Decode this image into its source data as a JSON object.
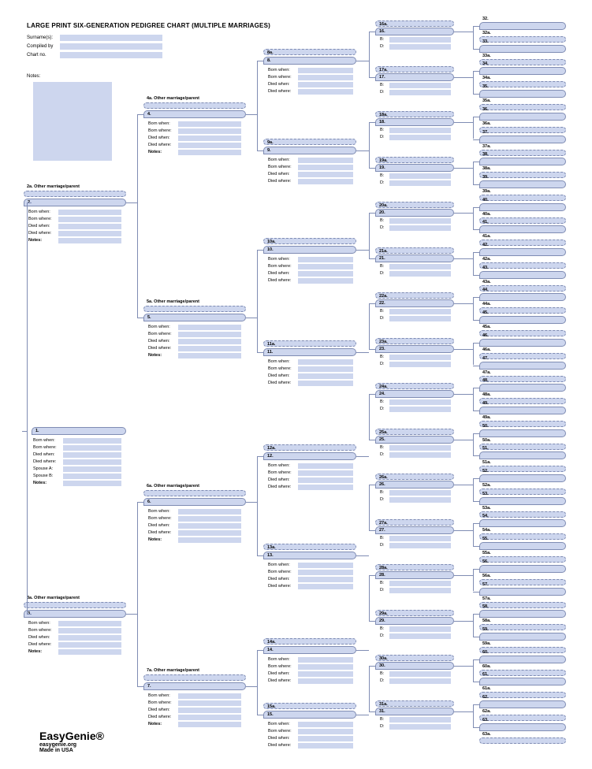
{
  "title": "LARGE PRINT SIX-GENERATION PEDIGREE CHART (MULTIPLE MARRIAGES)",
  "meta": {
    "surname": "Surname(s):",
    "compiled": "Compiled by",
    "chartno": "Chart no."
  },
  "notes_label": "Notes:",
  "labels": {
    "other": "Other marriage/parent",
    "bornwhen": "Born when:",
    "bornwhere": "Born where:",
    "diedwhen": "Died when:",
    "diedwhere": "Died where:",
    "notes": "Notes:",
    "spouseA": "Spouse A:",
    "spouseB": "Spouse B:",
    "b": "B:",
    "d": "D:"
  },
  "footer": {
    "brand": "EasyGenie®",
    "url": "easygenie.org",
    "made": "Made in USA"
  },
  "g1": {
    "num": "1."
  },
  "g2": [
    {
      "num": "2.",
      "alt": "2a."
    },
    {
      "num": "3.",
      "alt": "3a."
    }
  ],
  "g3": [
    {
      "num": "4.",
      "alt": "4a."
    },
    {
      "num": "5.",
      "alt": "5a."
    },
    {
      "num": "6.",
      "alt": "6a."
    },
    {
      "num": "7.",
      "alt": "7a."
    }
  ],
  "g4": [
    {
      "num": "8.",
      "alt": "8a."
    },
    {
      "num": "9.",
      "alt": "9a."
    },
    {
      "num": "10.",
      "alt": "10a."
    },
    {
      "num": "11.",
      "alt": "11a."
    },
    {
      "num": "12.",
      "alt": "12a."
    },
    {
      "num": "13.",
      "alt": "13a."
    },
    {
      "num": "14.",
      "alt": "14a."
    },
    {
      "num": "15.",
      "alt": "15a."
    }
  ],
  "g5": [
    {
      "num": "16.",
      "alt": "16a."
    },
    {
      "num": "17.",
      "alt": "17a."
    },
    {
      "num": "18.",
      "alt": "18a."
    },
    {
      "num": "19.",
      "alt": "19a."
    },
    {
      "num": "20.",
      "alt": "20a."
    },
    {
      "num": "21.",
      "alt": "21a."
    },
    {
      "num": "22.",
      "alt": "22a."
    },
    {
      "num": "23.",
      "alt": "23a."
    },
    {
      "num": "24.",
      "alt": "24a."
    },
    {
      "num": "25.",
      "alt": "25a."
    },
    {
      "num": "26.",
      "alt": "26a."
    },
    {
      "num": "27.",
      "alt": "27a."
    },
    {
      "num": "28.",
      "alt": "28a."
    },
    {
      "num": "29.",
      "alt": "29a."
    },
    {
      "num": "30.",
      "alt": "30a."
    },
    {
      "num": "31.",
      "alt": "31a."
    }
  ],
  "g6": [
    {
      "num": "32.",
      "alt": "32a."
    },
    {
      "num": "33.",
      "alt": "33a."
    },
    {
      "num": "34.",
      "alt": "34a."
    },
    {
      "num": "35.",
      "alt": "35a."
    },
    {
      "num": "36.",
      "alt": "36a."
    },
    {
      "num": "37.",
      "alt": "37a."
    },
    {
      "num": "38.",
      "alt": "38a."
    },
    {
      "num": "39.",
      "alt": "39a."
    },
    {
      "num": "40.",
      "alt": "40a."
    },
    {
      "num": "41.",
      "alt": "41a."
    },
    {
      "num": "42.",
      "alt": "42a."
    },
    {
      "num": "43.",
      "alt": "43a."
    },
    {
      "num": "44.",
      "alt": "44a."
    },
    {
      "num": "45.",
      "alt": "45a."
    },
    {
      "num": "46.",
      "alt": "46a."
    },
    {
      "num": "47.",
      "alt": "47a."
    },
    {
      "num": "48.",
      "alt": "48a."
    },
    {
      "num": "49.",
      "alt": "49a."
    },
    {
      "num": "50.",
      "alt": "50a."
    },
    {
      "num": "51.",
      "alt": "51a."
    },
    {
      "num": "52.",
      "alt": "52a."
    },
    {
      "num": "53.",
      "alt": "53a."
    },
    {
      "num": "54.",
      "alt": "54a."
    },
    {
      "num": "55.",
      "alt": "55a."
    },
    {
      "num": "56.",
      "alt": "56a."
    },
    {
      "num": "57.",
      "alt": "57a."
    },
    {
      "num": "58.",
      "alt": "58a."
    },
    {
      "num": "59.",
      "alt": "59a."
    },
    {
      "num": "60.",
      "alt": "60a."
    },
    {
      "num": "61.",
      "alt": "61a."
    },
    {
      "num": "62.",
      "alt": "62a."
    },
    {
      "num": "63.",
      "alt": "63a."
    }
  ]
}
